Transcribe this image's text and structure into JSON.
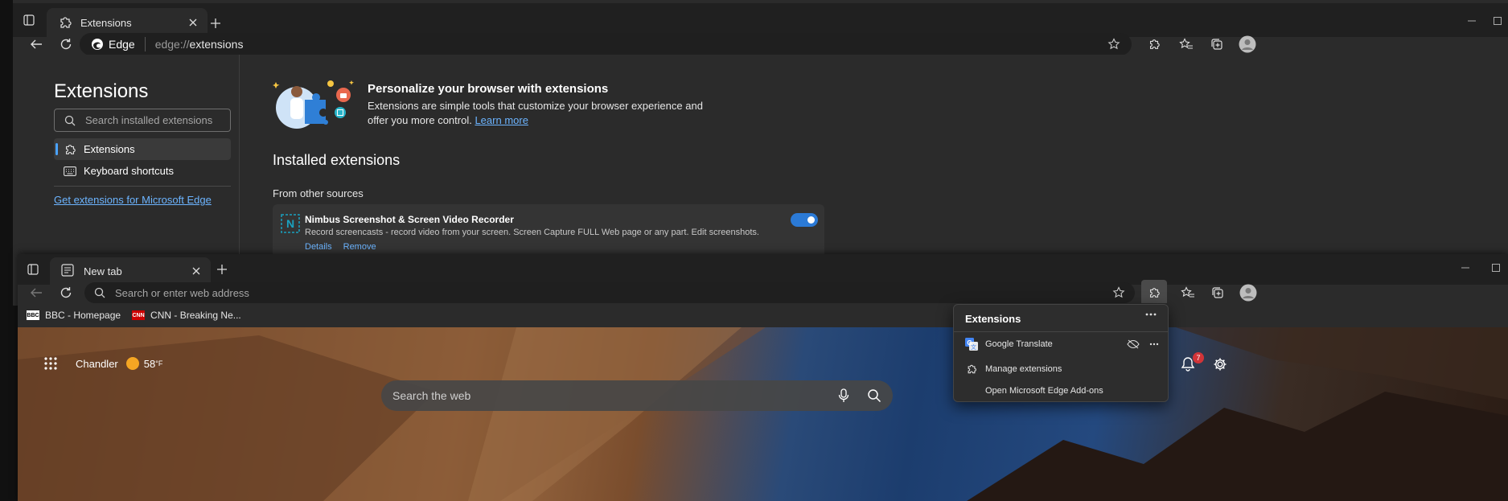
{
  "window1": {
    "tab": {
      "title": "Extensions"
    },
    "address": {
      "site_label": "Edge",
      "url_prefix": "edge://",
      "url_path": "extensions"
    }
  },
  "ext_page": {
    "sidebar": {
      "title": "Extensions",
      "search_placeholder": "Search installed extensions",
      "items": [
        {
          "label": "Extensions",
          "icon": "puzzle-icon",
          "active": true
        },
        {
          "label": "Keyboard shortcuts",
          "icon": "keyboard-icon",
          "active": false
        }
      ],
      "get_extensions_link": "Get extensions for Microsoft Edge"
    },
    "hero": {
      "title": "Personalize your browser with extensions",
      "description": "Extensions are simple tools that customize your browser experience and offer you more control.",
      "learn_more": "Learn more"
    },
    "installed_title": "Installed extensions",
    "section_label": "From other sources",
    "extensions": [
      {
        "name": "Nimbus Screenshot & Screen Video Recorder",
        "description": "Record screencasts - record video from your screen. Screen Capture FULL Web page or any part. Edit screenshots.",
        "details_label": "Details",
        "remove_label": "Remove",
        "enabled": true
      }
    ]
  },
  "window2": {
    "tab": {
      "title": "New tab"
    },
    "address": {
      "placeholder": "Search or enter web address"
    },
    "bookmarks": [
      {
        "label": "BBC - Homepage",
        "icon_text": "BBC"
      },
      {
        "label": "CNN - Breaking Ne...",
        "icon_text": "CNN"
      }
    ],
    "ntp": {
      "location": "Chandler",
      "temperature": "58",
      "temp_unit": "°F",
      "search_placeholder": "Search the web",
      "notification_count": "7"
    }
  },
  "ext_popup": {
    "title": "Extensions",
    "items": [
      {
        "label": "Google Translate",
        "icon": "google-translate-icon"
      },
      {
        "label": "Manage extensions",
        "icon": "puzzle-icon"
      },
      {
        "label": "Open Microsoft Edge Add-ons",
        "icon": ""
      }
    ]
  },
  "colors": {
    "accent": "#4aa3ff",
    "toggle_on": "#2b7ad6",
    "link": "#6cb4ff",
    "badge": "#d13438"
  }
}
